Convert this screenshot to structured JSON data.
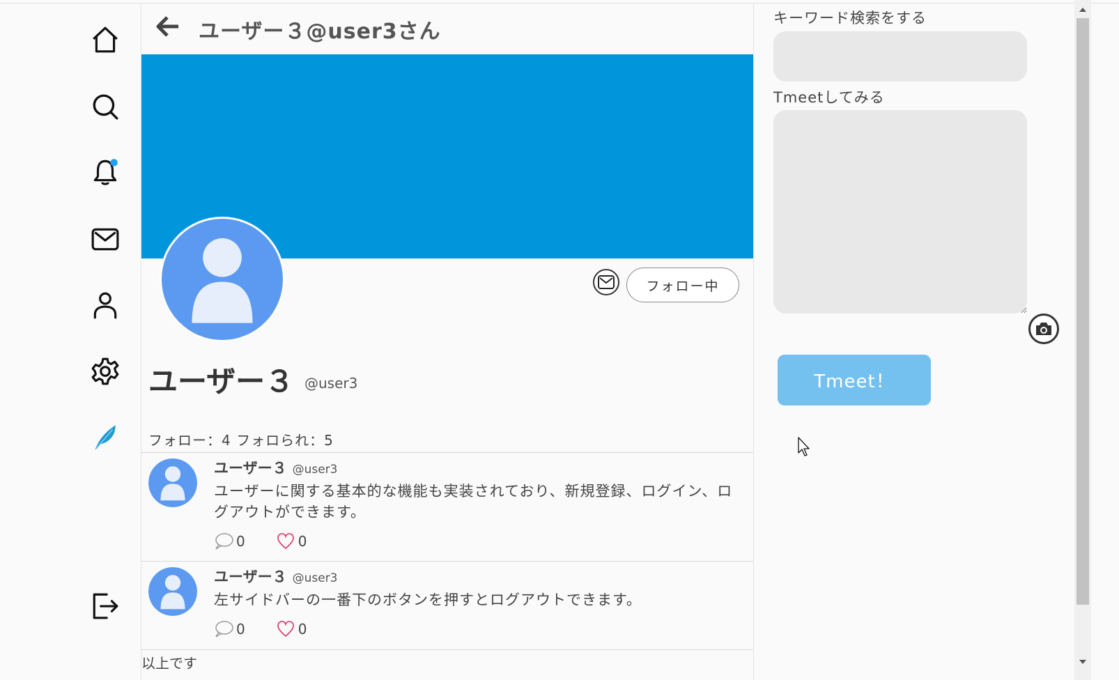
{
  "header": {
    "title": "ユーザー３@user3さん"
  },
  "profile": {
    "name": "ユーザー３",
    "handle": "@user3",
    "follow_button_label": "フォロー中",
    "stats": "フォロー：4 フォロられ：5"
  },
  "tweets": [
    {
      "name": "ユーザー３",
      "handle": "@user3",
      "text": "ユーザーに関する基本的な機能も実装されており、新規登録、ログイン、ログアウトができます。",
      "replies": "0",
      "likes": "0"
    },
    {
      "name": "ユーザー３",
      "handle": "@user3",
      "text": "左サイドバーの一番下のボタンを押すとログアウトできます。",
      "replies": "0",
      "likes": "0"
    }
  ],
  "footer_text": "以上です",
  "sidebar": {
    "search_label": "キーワード検索をする",
    "search_value": "",
    "tweet_label": "Tmeetしてみる",
    "tweet_value": "",
    "submit_label": "Tmeet！"
  },
  "nav": {
    "items": [
      "home-icon",
      "search-icon",
      "bell-icon",
      "mail-icon",
      "user-icon",
      "gear-icon",
      "feather-icon",
      "logout-icon"
    ]
  },
  "colors": {
    "banner": "#0196dc",
    "avatar": "#5b9af0",
    "avatar_figure": "#e7eefb",
    "notification_dot": "#1da1f2",
    "submit_button": "#74c1f0",
    "like_heart": "#d6336c"
  }
}
